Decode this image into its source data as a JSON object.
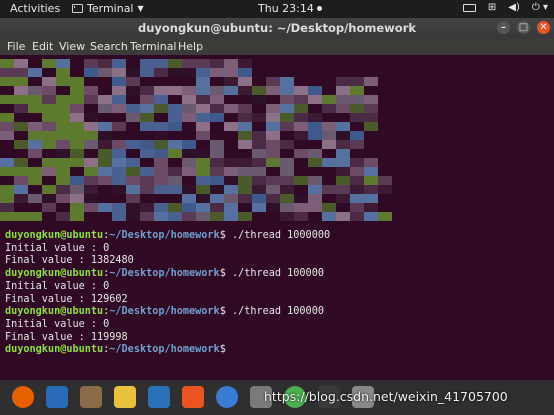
{
  "topbar": {
    "activities": "Activities",
    "app_menu": "Terminal",
    "clock": "Thu 23:14"
  },
  "window": {
    "title": "duyongkun@ubuntu: ~/Desktop/homework"
  },
  "menu": [
    "File",
    "Edit",
    "View",
    "Search",
    "Terminal",
    "Help"
  ],
  "terminal": {
    "lines": [
      {
        "user": "duyongkun@ubuntu",
        "path": "~/Desktop/homework",
        "cmd": " ./thread 1000000"
      },
      {
        "text": "Initial value : 0"
      },
      {
        "text": "Final value : 1382480"
      },
      {
        "user": "duyongkun@ubuntu",
        "path": "~/Desktop/homework",
        "cmd": " ./thread 100000"
      },
      {
        "text": "Initial value : 0"
      },
      {
        "text": "Final value : 129602"
      },
      {
        "user": "duyongkun@ubuntu",
        "path": "~/Desktop/homework",
        "cmd": " ./thread 100000"
      },
      {
        "text": "Initial value : 0"
      },
      {
        "text": "Final value : 119998"
      },
      {
        "user": "duyongkun@ubuntu",
        "path": "~/Desktop/homework",
        "cmd": ""
      }
    ]
  },
  "dock": {
    "icons": [
      {
        "name": "firefox-icon",
        "color": "#e66000"
      },
      {
        "name": "thunderbird-icon",
        "color": "#2a6bb8"
      },
      {
        "name": "files-icon",
        "color": "#8a6b4a"
      },
      {
        "name": "rhythmbox-icon",
        "color": "#e8c23a"
      },
      {
        "name": "libreoffice-writer-icon",
        "color": "#2b71b8"
      },
      {
        "name": "ubuntu-software-icon",
        "color": "#e95420"
      },
      {
        "name": "help-icon",
        "color": "#3a7bd5"
      },
      {
        "name": "settings-icon",
        "color": "#7a7a7a"
      },
      {
        "name": "chrome-icon",
        "color": "#4caf50"
      },
      {
        "name": "terminal-icon",
        "color": "#3a3a3a"
      },
      {
        "name": "trash-icon",
        "color": "#888888"
      }
    ],
    "watermark": "https://blog.csdn.net/weixin_41705700"
  }
}
